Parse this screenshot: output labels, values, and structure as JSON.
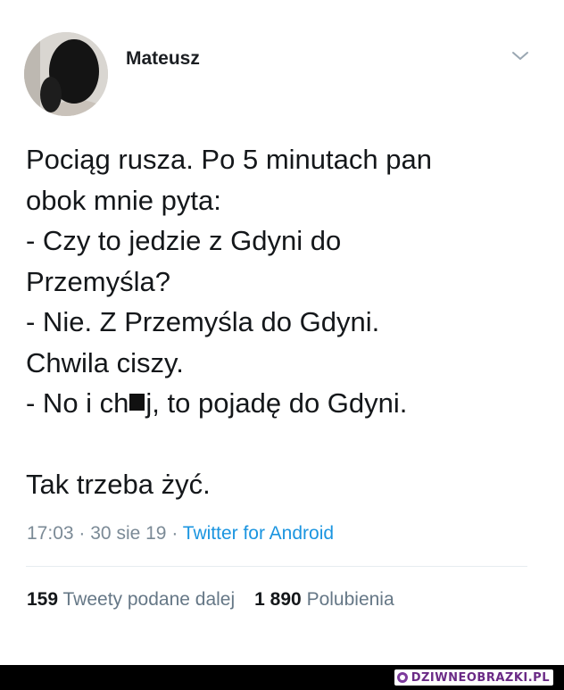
{
  "tweet": {
    "author_name": "Mateusz",
    "body_lines": [
      "Pociąg rusza. Po 5 minutach pan",
      "obok mnie pyta:",
      "- Czy to jedzie z Gdyni do",
      "Przemyśla?",
      "- Nie. Z Przemyśla do Gdyni.",
      "Chwila ciszy."
    ],
    "censored_line": {
      "before": "- No i ch",
      "after": "j, to pojadę do Gdyni."
    },
    "closing_line": "Tak trzeba żyć.",
    "time": "17:03",
    "date": "30 sie 19",
    "separator": "·",
    "source": "Twitter for Android",
    "retweets_count": "159",
    "retweets_label": "Tweety podane dalej",
    "likes_count": "1 890",
    "likes_label": "Polubienia"
  },
  "footer": {
    "watermark_text": "DZIWNEOBRAZKI.PL"
  },
  "icons": {
    "menu": "chevron-down-icon",
    "avatar": "avatar"
  },
  "colors": {
    "text": "#14171a",
    "muted": "#657786",
    "link": "#1b95e0",
    "divider": "#e6ecf0",
    "footer": "#000000",
    "watermark": "#6a2a86"
  }
}
